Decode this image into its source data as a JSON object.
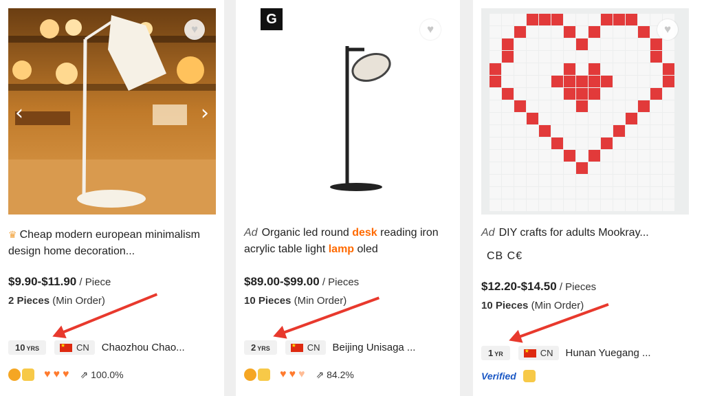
{
  "products": [
    {
      "title": "Cheap modern european minimalism design home decoration...",
      "price": "$9.90-$11.90",
      "unit": " / Piece",
      "moq_count": "2 Pieces",
      "moq_label": " (Min Order)",
      "years": "10",
      "years_unit": "YRS",
      "country": "CN",
      "supplier": "Chaozhou Chao...",
      "response_rate": "100.0%"
    },
    {
      "ad": "Ad",
      "title_a": "Organic led round ",
      "title_hl1": "desk",
      "title_b": " reading iron acrylic table light ",
      "title_hl2": "lamp",
      "title_c": " oled",
      "logo": "G",
      "price": "$89.00-$99.00",
      "unit": " / Pieces",
      "moq_count": "10 Pieces",
      "moq_label": " (Min Order)",
      "years": "2",
      "years_unit": "YRS",
      "country": "CN",
      "supplier": "Beijing Unisaga ...",
      "response_rate": "84.2%"
    },
    {
      "ad": "Ad",
      "title": "DIY crafts for adults Mookray...",
      "certs": "CB  C€",
      "price": "$12.20-$14.50",
      "unit": " / Pieces",
      "moq_count": "10 Pieces",
      "moq_label": " (Min Order)",
      "years": "1",
      "years_unit": "YR",
      "country": "CN",
      "supplier": "Hunan Yuegang ...",
      "verified": "Verified"
    }
  ],
  "icons": {
    "favorite": "heart-outline",
    "prev": "‹",
    "next": "›",
    "annotation_color": "#e8392d",
    "highlight_color": "#ff6a00"
  }
}
